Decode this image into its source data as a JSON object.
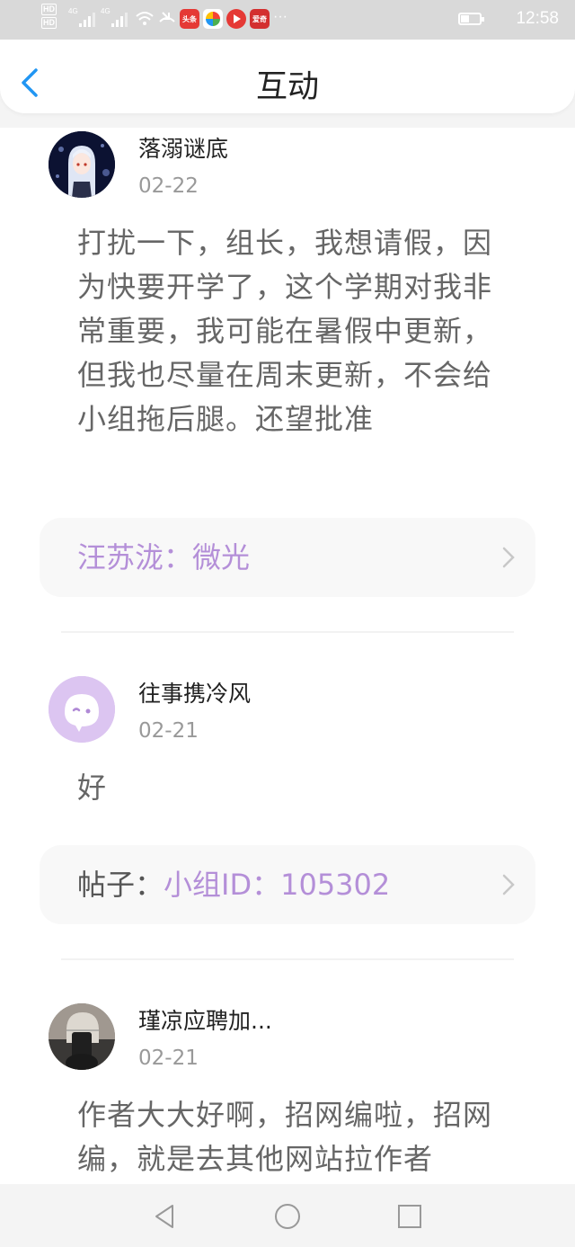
{
  "status_bar": {
    "time": "12:58",
    "network_1": "4G",
    "network_2": "4G",
    "app_icon_1_label": "头条",
    "app_icon_4_label": "爱奇"
  },
  "header": {
    "title": "互动"
  },
  "posts": [
    {
      "username": "落溺谜底",
      "date": "02-22",
      "content": "打扰一下，组长，我想请假，因为快要开学了，这个学期对我非常重要，我可能在暑假中更新，但我也尽量在周末更新，不会给小组拖后腿。还望批准",
      "ref_prefix": "",
      "ref_link": "汪苏泷：微光",
      "avatar_icon": "anime-avatar"
    },
    {
      "username": "往事携冷风",
      "date": "02-21",
      "content": "好",
      "ref_prefix": "帖子：",
      "ref_link": "小组ID：105302",
      "avatar_icon": "default-chat-avatar"
    },
    {
      "username": "瑾凉应聘加...",
      "date": "02-21",
      "content": "作者大大好啊，招网编啦，招网编，就是去其他网站拉作者",
      "avatar_icon": "photo-avatar"
    }
  ],
  "colors": {
    "accent_blue": "#2196f3",
    "link_purple": "#b48fd8",
    "status_bar_bg": "#d9d9d9"
  },
  "nav": {
    "back_icon": "triangle-back-icon",
    "home_icon": "circle-home-icon",
    "recents_icon": "square-recents-icon"
  }
}
